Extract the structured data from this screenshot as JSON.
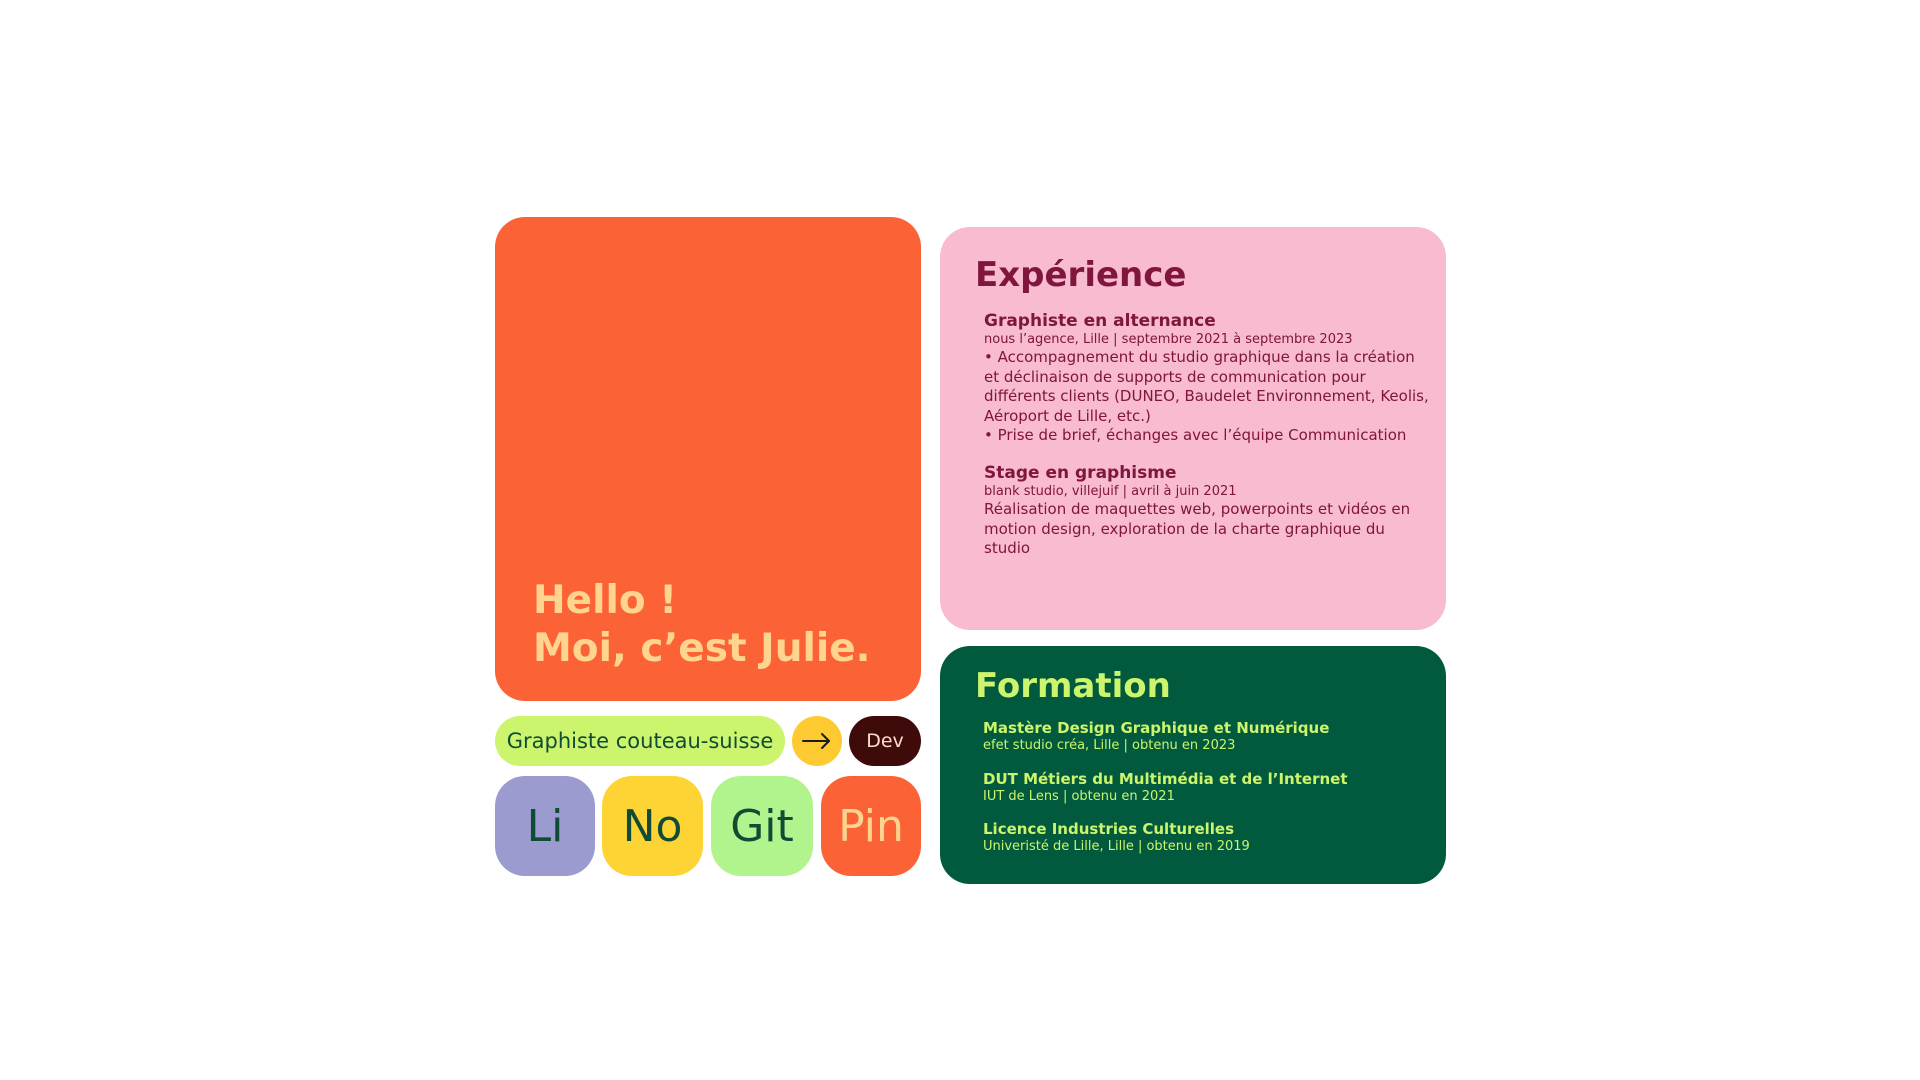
{
  "hero": {
    "line1": "Hello !",
    "line2": "Moi, c’est Julie."
  },
  "tags": {
    "graphiste": "Graphiste couteau-suisse",
    "dev": "Dev",
    "arrow_icon": "arrow-right-icon"
  },
  "socials": [
    {
      "label": "Li"
    },
    {
      "label": "No"
    },
    {
      "label": "Git"
    },
    {
      "label": "Pin"
    }
  ],
  "experience": {
    "title": "Expérience",
    "items": [
      {
        "role": "Graphiste en alternance",
        "meta": "nous l’agence, Lille | septembre 2021 à septembre 2023",
        "lines": [
          "• Accompagnement du studio graphique dans la création",
          "et déclinaison de supports de communication pour",
          "différents clients (DUNEO, Baudelet Environnement, Keolis,",
          "Aéroport de Lille, etc.)",
          "• Prise de brief, échanges avec l’équipe Communication"
        ]
      },
      {
        "role": "Stage en graphisme",
        "meta": "blank studio, villejuif | avril à juin 2021",
        "lines": [
          "Réalisation de maquettes web, powerpoints et vidéos en",
          "motion design, exploration de la charte graphique du studio"
        ]
      }
    ]
  },
  "formation": {
    "title": "Formation",
    "items": [
      {
        "degree": "Mastère Design Graphique et Numérique",
        "meta": "efet studio créa, Lille | obtenu en 2023"
      },
      {
        "degree": "DUT Métiers du Multimédia et de l’Internet",
        "meta": "IUT de Lens | obtenu en 2021"
      },
      {
        "degree": "Licence Industries Culturelles",
        "meta": "Univeristé de Lille, Lille | obtenu en 2019"
      }
    ]
  },
  "colors": {
    "orange": "#fb6337",
    "peach": "#fed48e",
    "lime": "#ccf46d",
    "yellow": "#fdca32",
    "maroon": "#3f0a0a",
    "lavender": "#9c9bcf",
    "green_light": "#b1f38c",
    "pink": "#f8bbcf",
    "wine": "#80153d",
    "forest": "#025a3e"
  }
}
